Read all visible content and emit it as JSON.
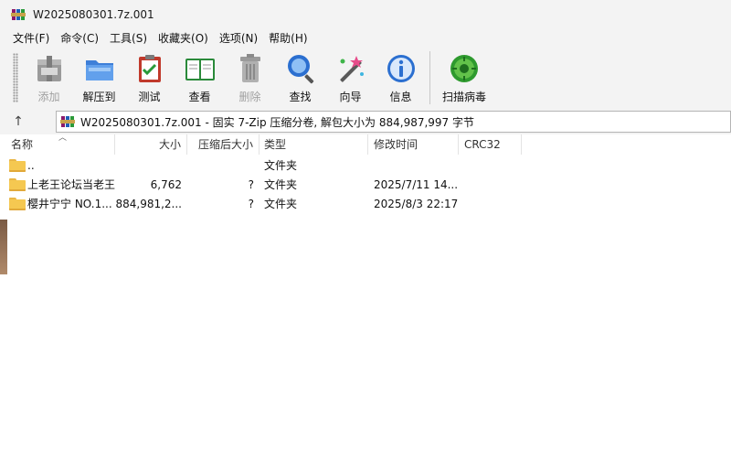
{
  "window": {
    "title": "W2025080301.7z.001"
  },
  "menu": [
    "文件(F)",
    "命令(C)",
    "工具(S)",
    "收藏夹(O)",
    "选项(N)",
    "帮助(H)"
  ],
  "toolbar": {
    "add": "添加",
    "extract": "解压到",
    "test": "测试",
    "view": "查看",
    "delete": "删除",
    "find": "查找",
    "wizard": "向导",
    "info": "信息",
    "scan": "扫描病毒"
  },
  "address": {
    "up": "↑",
    "path": "W2025080301.7z.001 - 固实 7-Zip 压缩分卷, 解包大小为 884,987,997 字节"
  },
  "columns": {
    "name": "名称",
    "size": "大小",
    "packed": "压缩后大小",
    "type": "类型",
    "modified": "修改时间",
    "crc": "CRC32"
  },
  "rows": [
    {
      "name": "..",
      "size": "",
      "packed": "",
      "type": "文件夹",
      "modified": ""
    },
    {
      "name": "上老王论坛当老王",
      "size": "6,762",
      "packed": "?",
      "type": "文件夹",
      "modified": "2025/7/11 14..."
    },
    {
      "name": "樱井宁宁 NO.1...",
      "size": "884,981,2...",
      "packed": "?",
      "type": "文件夹",
      "modified": "2025/8/3 22:17"
    }
  ],
  "colors": {
    "chrome": "#f3f3f3",
    "folder": "#f5c851"
  }
}
